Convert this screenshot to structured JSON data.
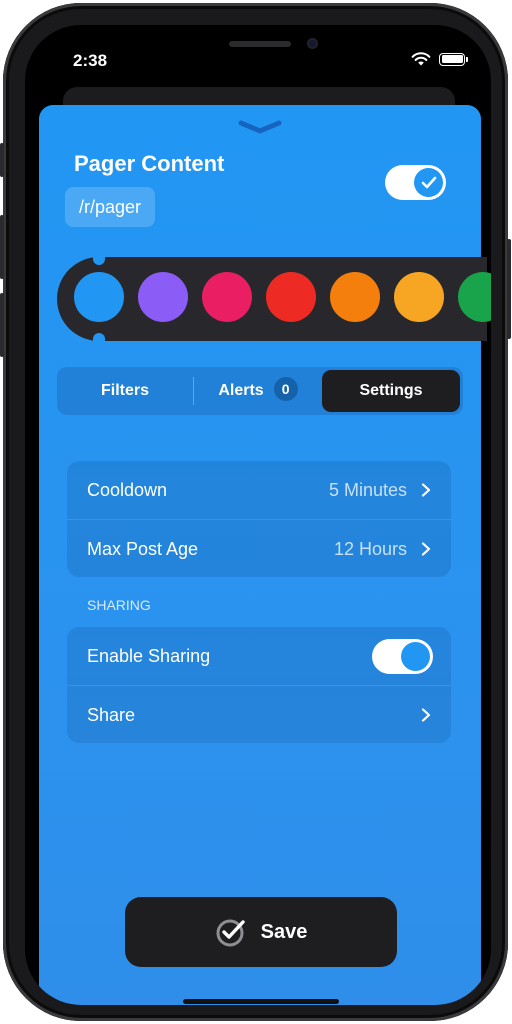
{
  "status_bar": {
    "time": "2:38",
    "icons": [
      "wifi-icon",
      "battery-icon"
    ]
  },
  "sheet": {
    "title": "Pager Content",
    "subreddit": "/r/pager",
    "enabled": true
  },
  "colors": {
    "selected": "#2196f3",
    "swatches": [
      "#2196f3",
      "#8b5cf6",
      "#e91e63",
      "#ee2a24",
      "#f57f0d",
      "#f7a623",
      "#19a34a"
    ]
  },
  "tabs": [
    {
      "label": "Filters"
    },
    {
      "label": "Alerts",
      "badge": "0"
    },
    {
      "label": "Settings",
      "active": true
    }
  ],
  "settings": {
    "cooldown_label": "Cooldown",
    "cooldown_value": "5 Minutes",
    "max_post_age_label": "Max Post Age",
    "max_post_age_value": "12 Hours"
  },
  "sharing": {
    "header": "SHARING",
    "enable_label": "Enable Sharing",
    "enabled": true,
    "share_label": "Share"
  },
  "save_label": "Save"
}
